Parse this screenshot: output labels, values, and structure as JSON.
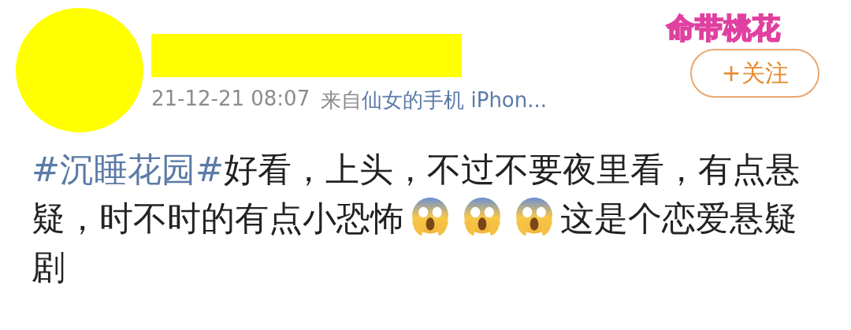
{
  "post": {
    "badge": "命带桃花",
    "follow_button": "+关注",
    "timestamp": "21-12-21 08:07",
    "source_prefix": "来自",
    "source": "仙女的手机 iPhon...",
    "content": [
      {
        "kind": "hashtag",
        "text": "#沉睡花园#"
      },
      {
        "kind": "text",
        "text": "好看，上头，不过不要夜里看，有点悬疑，时不时的有点小恐怖"
      },
      {
        "kind": "emoji"
      },
      {
        "kind": "emoji"
      },
      {
        "kind": "emoji"
      },
      {
        "kind": "text",
        "text": "这是个恋爱悬疑剧"
      }
    ]
  }
}
